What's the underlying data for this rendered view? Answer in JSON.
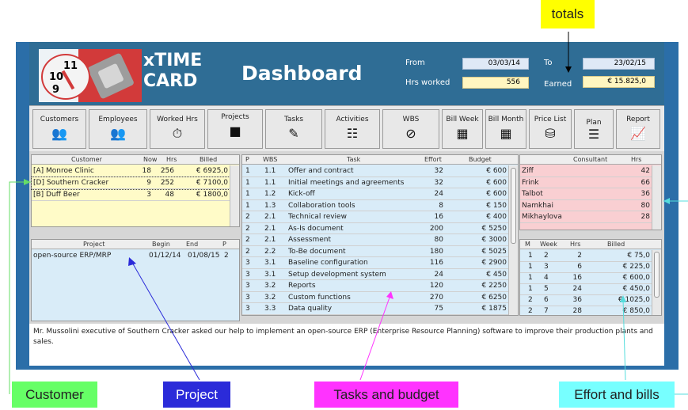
{
  "app": {
    "logo_line1": "xTIME",
    "logo_line2": "CARD",
    "clock_nums": [
      "11",
      "10",
      "9"
    ],
    "title": "Dashboard"
  },
  "header": {
    "from_label": "From",
    "from_value": "03/03/14",
    "to_label": "To",
    "to_value": "23/02/15",
    "hours_label": "Hrs worked",
    "hours_value": "556",
    "earned_label": "Earned",
    "earned_value": "€ 15.825,0"
  },
  "toolbar": [
    {
      "label": "Customers",
      "icon": "users-icon"
    },
    {
      "label": "Employees",
      "icon": "employees-icon"
    },
    {
      "label": "Worked Hrs",
      "icon": "worked-hours-icon"
    },
    {
      "label": "Projects",
      "icon": "projects-icon"
    },
    {
      "label": "Tasks",
      "icon": "pencil-icon"
    },
    {
      "label": "Activities",
      "icon": "clipboard-icon"
    },
    {
      "label": "WBS",
      "icon": "compass-icon"
    },
    {
      "label": "Bill Week",
      "icon": "calendar-icon"
    },
    {
      "label": "Bill Month",
      "icon": "calendar-icon"
    },
    {
      "label": "Price List",
      "icon": "coins-icon"
    },
    {
      "label": "Plan",
      "icon": "list-icon"
    },
    {
      "label": "Report",
      "icon": "chart-icon"
    }
  ],
  "customers": {
    "headers": [
      "Customer",
      "Now",
      "Hrs",
      "Billed"
    ],
    "rows": [
      [
        "[A] Monroe Clinic",
        "18",
        "256",
        "€ 6925,0"
      ],
      [
        "[D] Southern Cracker",
        "9",
        "252",
        "€ 7100,0"
      ],
      [
        "[B] Duff Beer",
        "3",
        "48",
        "€ 1800,0"
      ]
    ]
  },
  "projects": {
    "headers": [
      "Project",
      "Begin",
      "End",
      "P"
    ],
    "rows": [
      [
        "open-source ERP/MRP",
        "01/12/14",
        "01/08/15",
        "2"
      ]
    ]
  },
  "tasks": {
    "headers": [
      "P",
      "WBS",
      "Task",
      "Effort",
      "Budget"
    ],
    "rows": [
      [
        "1",
        "1.1",
        "Offer and contract",
        "32",
        "€ 600"
      ],
      [
        "1",
        "1.1",
        "Initial meetings and agreements",
        "32",
        "€ 600"
      ],
      [
        "1",
        "1.2",
        "Kick-off",
        "24",
        "€ 600"
      ],
      [
        "1",
        "1.3",
        "Collaboration tools",
        "8",
        "€ 150"
      ],
      [
        "2",
        "2.1",
        "Technical review",
        "16",
        "€ 400"
      ],
      [
        "2",
        "2.1",
        "As-Is document",
        "200",
        "€ 5250"
      ],
      [
        "2",
        "2.1",
        "Assessment",
        "80",
        "€ 3000"
      ],
      [
        "2",
        "2.2",
        "To-Be document",
        "180",
        "€ 5025"
      ],
      [
        "3",
        "3.1",
        "Baseline configuration",
        "116",
        "€ 2900"
      ],
      [
        "3",
        "3.1",
        "Setup development system",
        "24",
        "€ 450"
      ],
      [
        "3",
        "3.2",
        "Reports",
        "120",
        "€ 2250"
      ],
      [
        "3",
        "3.2",
        "Custom functions",
        "270",
        "€ 6250"
      ],
      [
        "3",
        "3.3",
        "Data quality",
        "75",
        "€ 1875"
      ]
    ]
  },
  "consultants": {
    "headers": [
      "Consultant",
      "Hrs"
    ],
    "rows": [
      [
        "Ziff",
        "42"
      ],
      [
        "Frink",
        "66"
      ],
      [
        "Talbot",
        "36"
      ],
      [
        "Namkhai",
        "80"
      ],
      [
        "Mikhaylova",
        "28"
      ]
    ]
  },
  "bills": {
    "headers": [
      "M",
      "Week",
      "Hrs",
      "Billed"
    ],
    "rows": [
      [
        "1",
        "2",
        "2",
        "€ 75,0"
      ],
      [
        "1",
        "3",
        "6",
        "€ 225,0"
      ],
      [
        "1",
        "4",
        "16",
        "€ 600,0"
      ],
      [
        "1",
        "5",
        "24",
        "€ 450,0"
      ],
      [
        "2",
        "6",
        "36",
        "€ 1025,0"
      ],
      [
        "2",
        "7",
        "28",
        "€ 850,0"
      ]
    ]
  },
  "description": "Mr. Mussolini executive of Southern Cracker asked our help to implement an open-source ERP (Enterprise Resource Planning) software to improve their production plants and sales.",
  "callouts": {
    "totals": "totals",
    "customer": "Customer",
    "project": "Project",
    "tasks": "Tasks and budget",
    "effort": "Effort and bills"
  },
  "colors": {
    "header": "#2f6d95",
    "customer_bg": "#fffbc8",
    "project_bg": "#d9ecf8",
    "consultant_bg": "#f9cfd2",
    "callout_yellow": "#ffff00",
    "callout_green": "#66ff66",
    "callout_blue": "#2b2bd9",
    "callout_magenta": "#ff33ff",
    "callout_cyan": "#77ffff"
  }
}
